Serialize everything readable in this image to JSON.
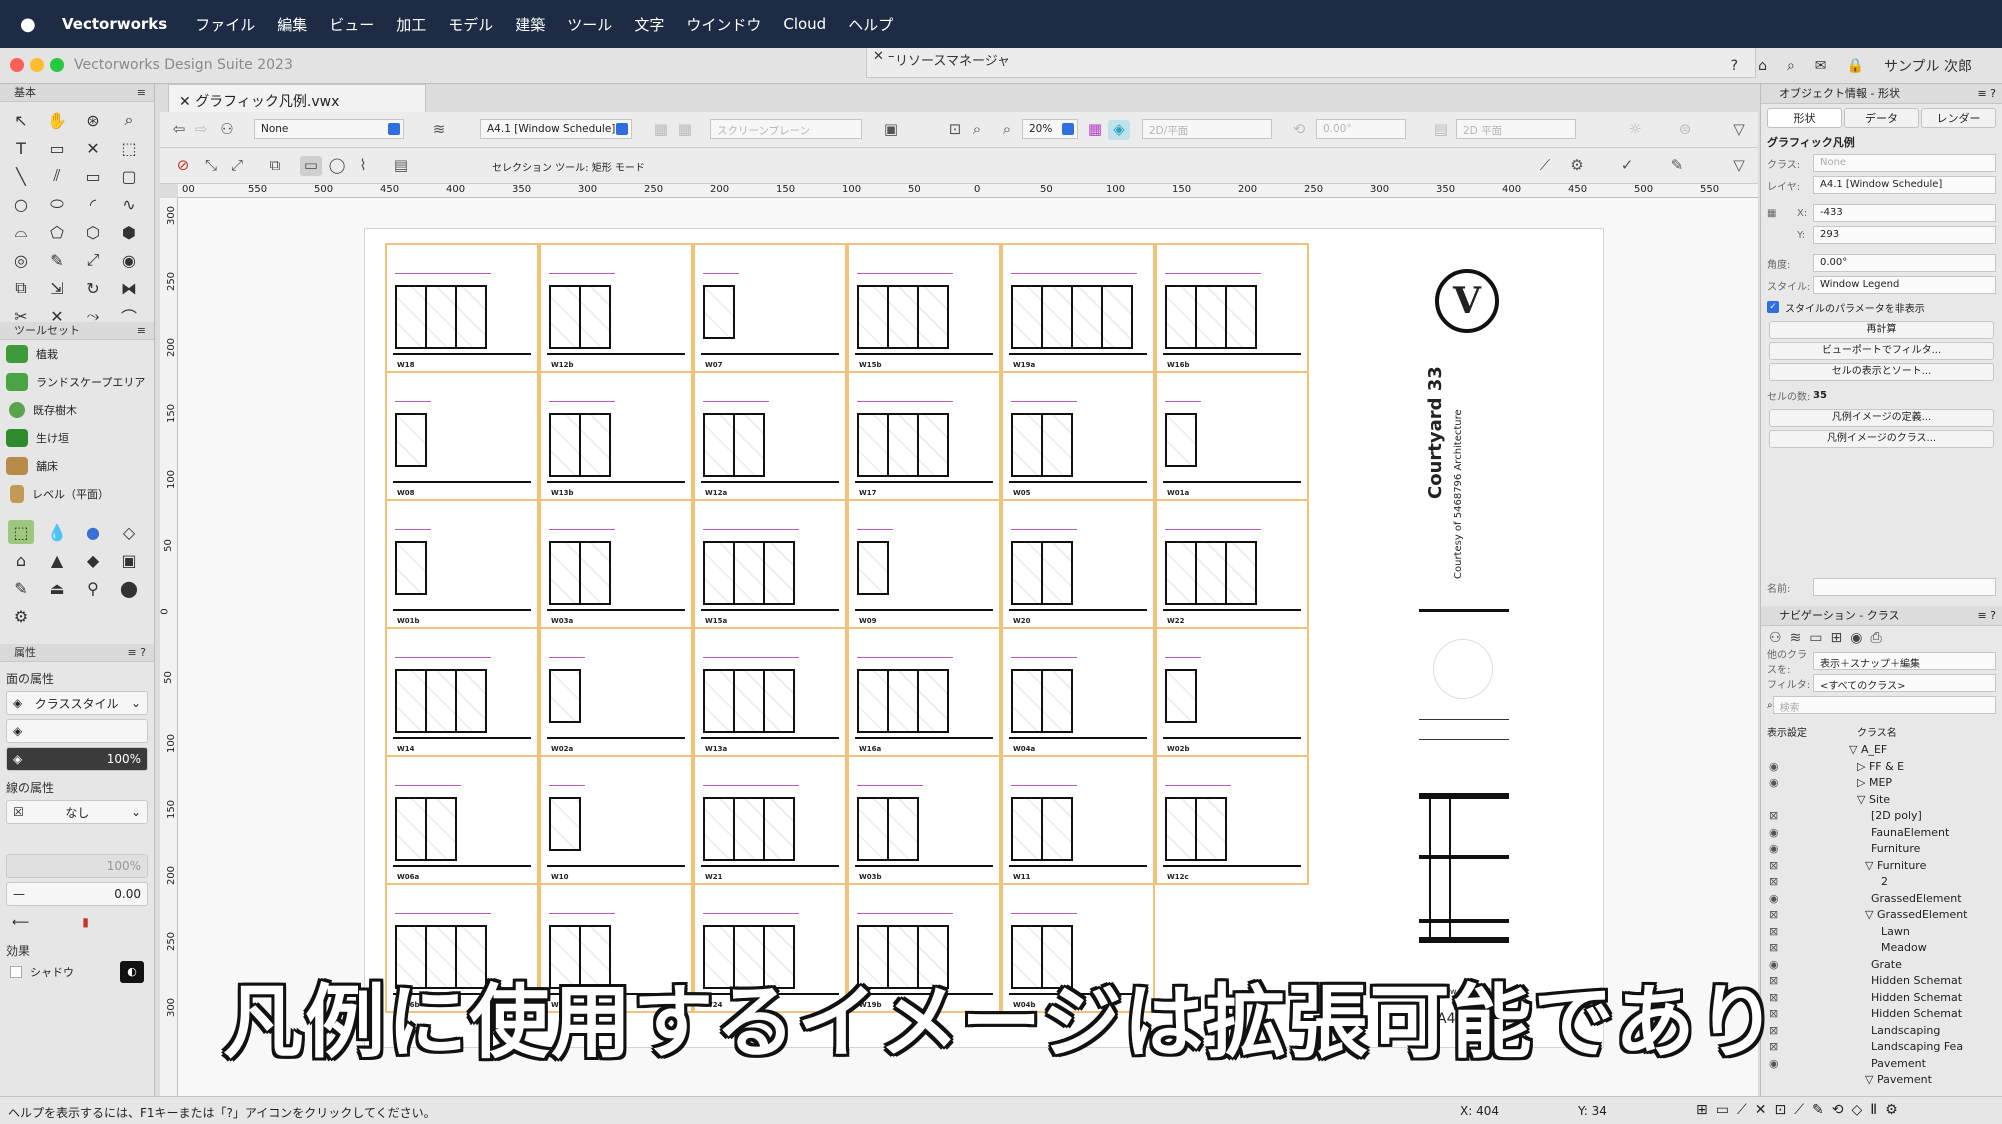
{
  "menubar": {
    "app": "Vectorworks",
    "items": [
      "ファイル",
      "編集",
      "ビュー",
      "加工",
      "モデル",
      "建築",
      "ツール",
      "文字",
      "ウインドウ",
      "Cloud",
      "ヘルプ"
    ]
  },
  "window": {
    "title": "Vectorworks Design Suite 2023",
    "resource_manager": "リソースマネージャ",
    "user": "サンプル 次郎"
  },
  "document": {
    "tab": "グラフィック凡例.vwx"
  },
  "toolbar": {
    "class": "None",
    "layer": "A4.1 [Window Schedule]",
    "screen_plane": "スクリーンプレーン",
    "zoom": "20%",
    "view": "2D/平面",
    "angle": "0.00°",
    "plane": "2D 平面",
    "mode_hint": "セレクション ツール: 矩形 モード"
  },
  "palettes": {
    "basic": "基本",
    "toolset": "ツールセット",
    "toolset_items": [
      "植栽",
      "ランドスケープエリア",
      "既存樹木",
      "生け垣",
      "舗床",
      "レベル（平面）"
    ],
    "attributes": "属性",
    "fill_label": "面の属性",
    "fill_value": "クラススタイル",
    "opacity": "100%",
    "line_label": "線の属性",
    "line_value": "なし",
    "line_opacity": "100%",
    "line_weight": "0.00",
    "effects": "効果",
    "shadow": "シャドウ"
  },
  "ruler": {
    "h": [
      "00",
      "550",
      "500",
      "450",
      "400",
      "350",
      "300",
      "250",
      "200",
      "150",
      "100",
      "50",
      "0",
      "50",
      "100",
      "150",
      "200",
      "250",
      "300",
      "350",
      "400",
      "450",
      "500",
      "550"
    ],
    "v": [
      "300",
      "250",
      "200",
      "150",
      "100",
      "50",
      "0",
      "50",
      "100",
      "150",
      "200",
      "250",
      "300"
    ]
  },
  "legend_cells": [
    [
      "W18",
      "W12b",
      "W07",
      "W15b",
      "W19a",
      "W16b"
    ],
    [
      "W08",
      "W13b",
      "W12a",
      "W17",
      "W05",
      "W01a"
    ],
    [
      "W01b",
      "W03a",
      "W15a",
      "W09",
      "W20",
      "W22"
    ],
    [
      "W14",
      "W02a",
      "W13a",
      "W16a",
      "W04a",
      "W02b"
    ],
    [
      "W06a",
      "W10",
      "W21",
      "W03b",
      "W11",
      "W12c"
    ],
    [
      "W06b",
      "W23",
      "W24",
      "W19b",
      "W04b",
      ""
    ]
  ],
  "titleblock": {
    "logo": "V",
    "project": "Courtyard 33",
    "courtesy": "Courtesy of 5468796 Architecture",
    "schedule": "Window Schedule",
    "sheet": "A4.1"
  },
  "object_info": {
    "title": "オブジェクト情報 - 形状",
    "tabs": [
      "形状",
      "データ",
      "レンダー"
    ],
    "object_type": "グラフィック凡例",
    "class_label": "クラス:",
    "class": "None",
    "layer_label": "レイヤ:",
    "layer": "A4.1 [Window Schedule]",
    "x_label": "X:",
    "x": "-433",
    "y_label": "Y:",
    "y": "293",
    "angle_label": "角度:",
    "angle": "0.00°",
    "style_label": "スタイル:",
    "style": "Window Legend",
    "hide_params": "スタイルのパラメータを非表示",
    "buttons": [
      "再計算",
      "ビューポートでフィルタ...",
      "セルの表示とソート..."
    ],
    "cell_count_label": "セルの数:",
    "cell_count": "35",
    "buttons2": [
      "凡例イメージの定義...",
      "凡例イメージのクラス..."
    ],
    "name_label": "名前:"
  },
  "navigation": {
    "title": "ナビゲーション - クラス",
    "other_label": "他のクラスを:",
    "other_value": "表示＋スナップ＋編集",
    "filter_label": "フィルタ:",
    "filter_value": "<すべてのクラス>",
    "search_placeholder": "検索",
    "col_visibility": "表示設定",
    "col_name": "クラス名",
    "classes": [
      "▽ A_EF",
      "▷ FF & E",
      "▷ MEP",
      "▽ Site",
      "[2D poly]",
      "FaunaElement",
      "Furniture",
      "▽ Furniture",
      "2",
      "GrassedElement",
      "▽ GrassedElement",
      "Lawn",
      "Meadow",
      "Grate",
      "Hidden Schemat",
      "Hidden Schemat",
      "Hidden Schemat",
      "Landscaping",
      "Landscaping Fea",
      "Pavement",
      "▽ Pavement"
    ]
  },
  "statusbar": {
    "help": "ヘルプを表示するには、F1キーまたは「?」アイコンをクリックしてください。",
    "x": "X: 404",
    "y": "Y: 34"
  },
  "subtitle": "凡例に使用するイメージは拡張可能であり",
  "colors": {
    "menubar": "#1d2c44",
    "cell_border": "#f0c27a",
    "dimension": "#c056c7",
    "accent": "#2f6fe0"
  }
}
